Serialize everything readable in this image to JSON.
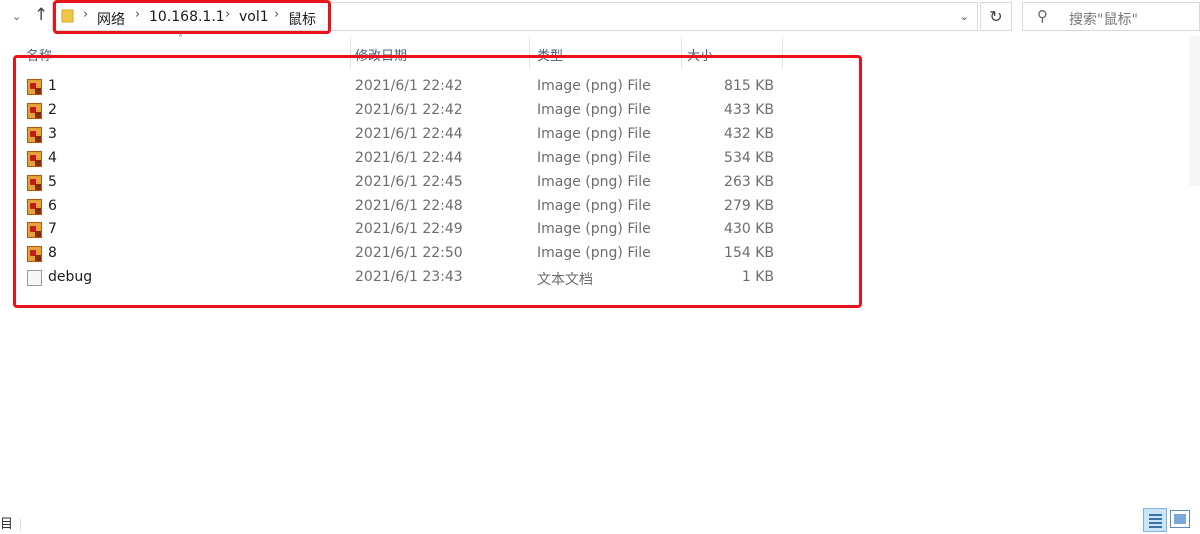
{
  "address": {
    "crumbs": [
      "网络",
      "10.168.1.1",
      "vol1",
      "鼠标"
    ]
  },
  "search": {
    "placeholder": "搜索\"鼠标\""
  },
  "columns": {
    "name": "名称",
    "date": "修改日期",
    "type": "类型",
    "size": "大小"
  },
  "files": [
    {
      "name": "1",
      "date": "2021/6/1 22:42",
      "type": "Image (png) File",
      "size": "815 KB",
      "icon": "png-image-icon"
    },
    {
      "name": "2",
      "date": "2021/6/1 22:42",
      "type": "Image (png) File",
      "size": "433 KB",
      "icon": "png-image-icon"
    },
    {
      "name": "3",
      "date": "2021/6/1 22:44",
      "type": "Image (png) File",
      "size": "432 KB",
      "icon": "png-image-icon"
    },
    {
      "name": "4",
      "date": "2021/6/1 22:44",
      "type": "Image (png) File",
      "size": "534 KB",
      "icon": "png-image-icon"
    },
    {
      "name": "5",
      "date": "2021/6/1 22:45",
      "type": "Image (png) File",
      "size": "263 KB",
      "icon": "png-image-icon"
    },
    {
      "name": "6",
      "date": "2021/6/1 22:48",
      "type": "Image (png) File",
      "size": "279 KB",
      "icon": "png-image-icon"
    },
    {
      "name": "7",
      "date": "2021/6/1 22:49",
      "type": "Image (png) File",
      "size": "430 KB",
      "icon": "png-image-icon"
    },
    {
      "name": "8",
      "date": "2021/6/1 22:50",
      "type": "Image (png) File",
      "size": "154 KB",
      "icon": "png-image-icon"
    },
    {
      "name": "debug",
      "date": "2021/6/1 23:43",
      "type": "文本文档",
      "size": "1 KB",
      "icon": "text-document-icon"
    }
  ],
  "status": {
    "left_text": "目"
  },
  "colors": {
    "highlight": "#e8131b",
    "selected_view": "#cce4f7"
  }
}
